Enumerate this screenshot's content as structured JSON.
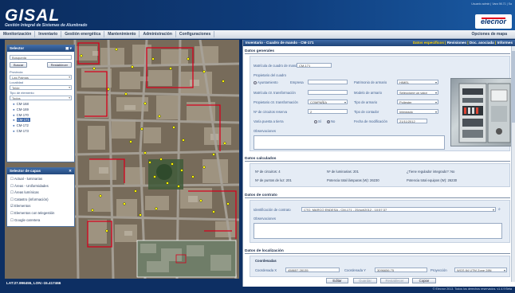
{
  "header": {
    "app_name": "GISAL",
    "tagline": "Gestión Integral de Sistemas de Alumbrado",
    "user_bar": "Usuario admin | Vara 98.71 | Sa",
    "brand": "elecnor"
  },
  "menu": {
    "items": [
      "Monitorización",
      "Inventario",
      "Gestión energética",
      "Mantenimiento",
      "Administración",
      "Configuraciones"
    ],
    "map_options": "Opciones de mapa"
  },
  "selector": {
    "title": "Selector",
    "search_placeholder": "Búsqueda",
    "search_button": "Buscar",
    "reset_button": "Restablecer",
    "label_provincia": "Provincia",
    "provincia_value": "Las Palmas",
    "label_localidad": "Localidad",
    "localidad_value": "Telde",
    "label_tipo": "Tipo de elemento",
    "tipo_value": "Todos",
    "list": [
      "CM-168",
      "CM-169",
      "CM-170",
      "CM-171",
      "CM-172",
      "CM-173"
    ],
    "selected_item": "CM-171"
  },
  "layers": {
    "title": "Selector de capas",
    "items": [
      "Actual - luminarias",
      "Áreas - Uniformidades",
      "Áreas lumínicas",
      "Catastro (información)",
      "Elementos",
      "Elementos con telegestión",
      "Google carretera"
    ],
    "checked": [
      "Elementos"
    ]
  },
  "map": {
    "coords": "LAT:27.996455, LON:-15.417466"
  },
  "panel": {
    "breadcrumb": "Inventario - Cuadro de mando - CM-171",
    "tabs": [
      "Datos específicos",
      "Revisiones",
      "Doc. asociada",
      "Informes"
    ],
    "sections": {
      "general": "Datos generales",
      "calculated": "Datos calculados",
      "contract": "Datos de contrato",
      "location": "Datos de localización",
      "coordinates": "Coordenadas"
    },
    "general": {
      "matricula_label": "Matrícula de cuadro de mando",
      "matricula_value": "CM-171",
      "propietario_label": "Propietario del cuadro",
      "ayuntamiento_label": "Ayuntamiento",
      "empresa_label": "Empresa",
      "patrimonio_label": "Patrimonio de armario",
      "patrimonio_value": "HIMEL",
      "mat_transformacion_label": "Matrícula ctr. transformación",
      "modelo_label": "Modelo de armario",
      "modelo_value": "Seleccione un valor",
      "propietario_ct_label": "Propietario ctr. transformación",
      "propietario_ct_value": "COMPAÑÍA",
      "tipo_armario_label": "Tipo de armario",
      "tipo_armario_value": "Poliester",
      "circuitos_label": "Nº de circuitos reserva",
      "circuitos_value": "2",
      "tipo_contador_label": "Tipo de contador",
      "tipo_contador_value": "Integrado",
      "puesta_tierra_label": "Varía puesta a tierra",
      "si_label": "Sí",
      "no_label": "No",
      "fecha_label": "Fecha de modificación",
      "fecha_value": "21/11/2012",
      "observaciones_label": "Observaciones"
    },
    "calculated": {
      "circuitos_label": "Nº de circuitos:",
      "circuitos_value": "4",
      "luminarias_label": "Nº de luminarias:",
      "luminarias_value": "201",
      "integrado_label": "¿Tiene regulador integrado?:",
      "integrado_value": "No",
      "puntos_label": "Nº de puntos de luz:",
      "puntos_value": "201",
      "potencia_lamparas_label": "Potencia total lámparas (W):",
      "potencia_lamparas_value": "26230",
      "potencia_equipos_label": "Potencia total equipos (W):",
      "potencia_equipos_value": "26230"
    },
    "contract": {
      "id_label": "Identificación de contrato",
      "id_value": "CTO. MARCO ENDESA - CM-171 - 25/oct/2012 - 10:57:37",
      "obs_label": "Observaciones"
    },
    "location": {
      "x_label": "Coordenada X",
      "x_value": "458657.28135",
      "y_label": "Coordenada Y",
      "y_value": "3096656.75",
      "proj_label": "Proyección",
      "proj_value": "WGS 84 UTM Zone 28N"
    },
    "buttons": [
      "Editar",
      "Guardar",
      "Restablecer",
      "Copiar"
    ]
  },
  "footer": {
    "copyright": "© Elecnor 2013. Todos los derechos reservados. v1.4.9 Beta"
  }
}
